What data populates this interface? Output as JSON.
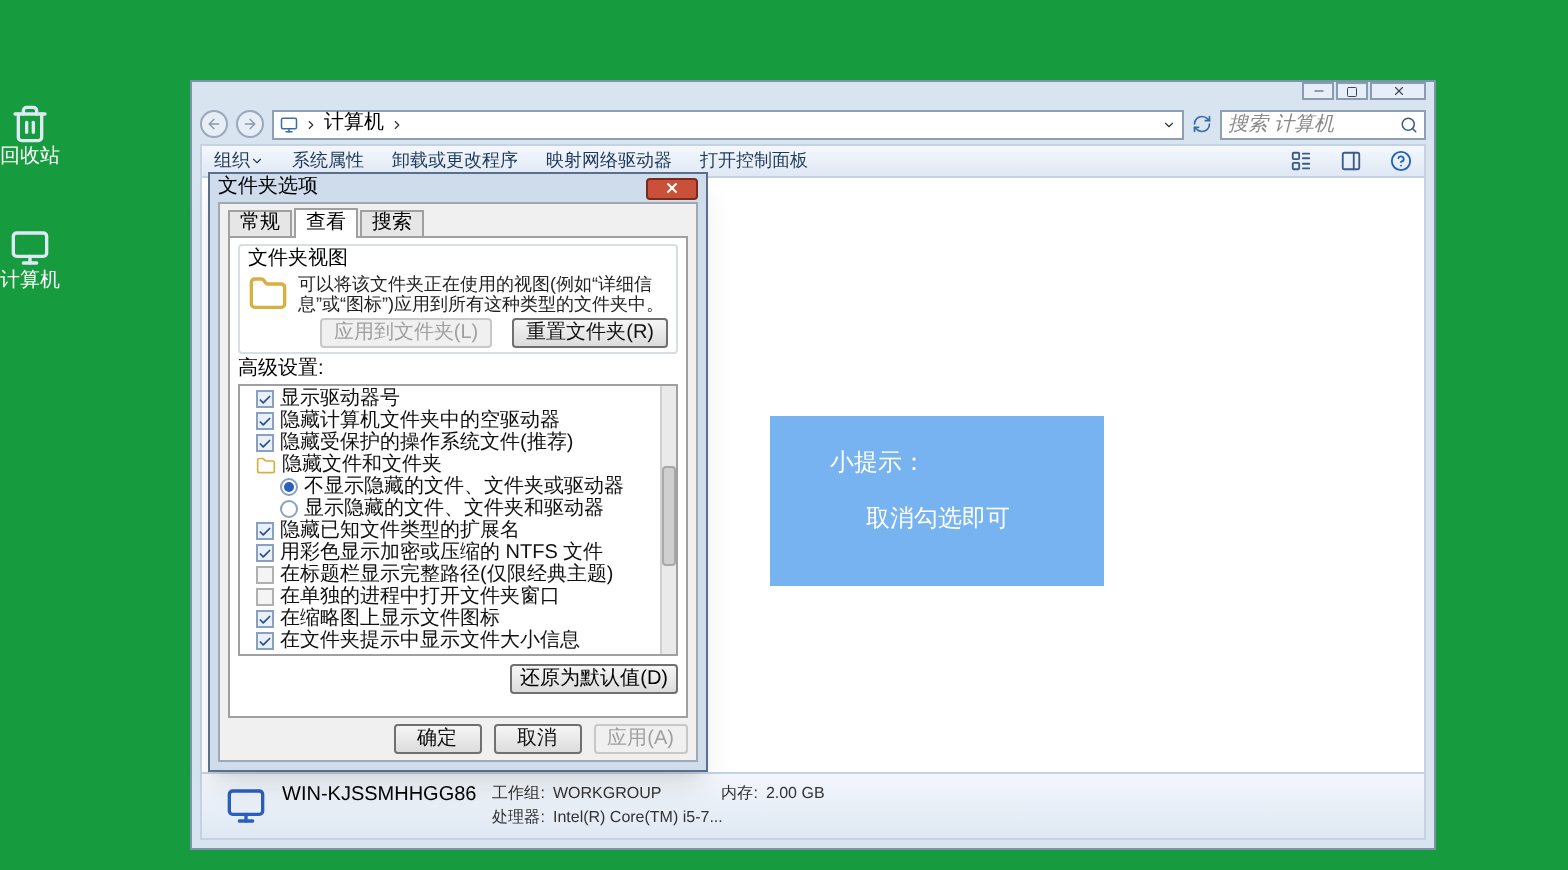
{
  "desktop_icons": [
    {
      "kind": "recycle",
      "label": "回收站"
    },
    {
      "kind": "computer",
      "label": "计算机"
    }
  ],
  "explorer": {
    "address": "计算机",
    "search": {
      "placeholder": "搜索 计算机"
    },
    "toolbar": [
      {
        "label": "组织",
        "dropdown": true
      },
      {
        "label": "系统属性",
        "dropdown": false
      },
      {
        "label": "卸载或更改程序",
        "dropdown": false
      },
      {
        "label": "映射网络驱动器",
        "dropdown": false
      },
      {
        "label": "打开控制面板",
        "dropdown": false
      }
    ],
    "computer": {
      "name": "WIN-KJSSMHHGG86",
      "workgroup_label": "工作组:",
      "workgroup": "WORKGROUP",
      "memory_label": "内存:",
      "memory": "2.00 GB",
      "processor_label": "处理器:",
      "processor": "Intel(R) Core(TM) i5-7..."
    }
  },
  "tip": {
    "title": "小提示：",
    "text": "取消勾选即可"
  },
  "dialog": {
    "title": "文件夹选项",
    "tabs": [
      {
        "label": "常规",
        "selected": false
      },
      {
        "label": "查看",
        "selected": true
      },
      {
        "label": "搜索",
        "selected": false
      }
    ],
    "folder_views": {
      "title": "文件夹视图",
      "description": "可以将该文件夹正在使用的视图(例如“详细信息”或“图标”)应用到所有这种类型的文件夹中。",
      "buttons": [
        {
          "label": "应用到文件夹(L)",
          "disabled": true
        },
        {
          "label": "重置文件夹(R)",
          "disabled": false
        }
      ]
    },
    "advanced_label": "高级设置:",
    "settings": [
      {
        "kind": "checkbox",
        "label": "显示驱动器号",
        "checked": true
      },
      {
        "kind": "checkbox",
        "label": "隐藏计算机文件夹中的空驱动器",
        "checked": true
      },
      {
        "kind": "checkbox",
        "label": "隐藏受保护的操作系统文件(推荐)",
        "checked": true
      },
      {
        "kind": "folder",
        "label": "隐藏文件和文件夹",
        "children": [
          {
            "kind": "radio",
            "label": "不显示隐藏的文件、文件夹或驱动器",
            "selected": true
          },
          {
            "kind": "radio",
            "label": "显示隐藏的文件、文件夹和驱动器",
            "selected": false
          }
        ]
      },
      {
        "kind": "checkbox",
        "label": "隐藏已知文件类型的扩展名",
        "checked": true
      },
      {
        "kind": "checkbox",
        "label": "用彩色显示加密或压缩的 NTFS 文件",
        "checked": true
      },
      {
        "kind": "checkbox",
        "label": "在标题栏显示完整路径(仅限经典主题)",
        "checked": false
      },
      {
        "kind": "checkbox",
        "label": "在单独的进程中打开文件夹窗口",
        "checked": false
      },
      {
        "kind": "checkbox",
        "label": "在缩略图上显示文件图标",
        "checked": true
      },
      {
        "kind": "checkbox",
        "label": "在文件夹提示中显示文件大小信息",
        "checked": true
      }
    ],
    "restore_button": "还原为默认值(D)",
    "buttons": [
      {
        "label": "确定",
        "disabled": false
      },
      {
        "label": "取消",
        "disabled": false
      },
      {
        "label": "应用(A)",
        "disabled": true
      }
    ]
  }
}
